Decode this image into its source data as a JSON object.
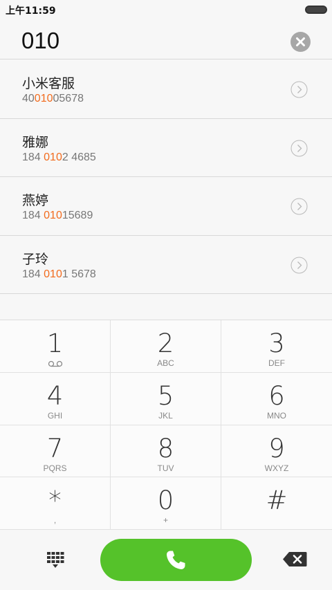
{
  "status": {
    "time": "上午11:59"
  },
  "input": {
    "number": "010"
  },
  "results": [
    {
      "name": "小米客服",
      "num_pre": "40",
      "num_hl": "010",
      "num_post": "05678"
    },
    {
      "name": "雅娜",
      "num_pre": "184 ",
      "num_hl": "010",
      "num_post": "2 4685"
    },
    {
      "name": "燕婷",
      "num_pre": "184 ",
      "num_hl": "010",
      "num_post": "15689"
    },
    {
      "name": "子玲",
      "num_pre": "184 ",
      "num_hl": "010",
      "num_post": "1 5678"
    }
  ],
  "keypad": [
    {
      "digit": "1",
      "letters": ""
    },
    {
      "digit": "2",
      "letters": "ABC"
    },
    {
      "digit": "3",
      "letters": "DEF"
    },
    {
      "digit": "4",
      "letters": "GHI"
    },
    {
      "digit": "5",
      "letters": "JKL"
    },
    {
      "digit": "6",
      "letters": "MNO"
    },
    {
      "digit": "7",
      "letters": "PQRS"
    },
    {
      "digit": "8",
      "letters": "TUV"
    },
    {
      "digit": "9",
      "letters": "WXYZ"
    },
    {
      "digit": "*",
      "letters": ","
    },
    {
      "digit": "0",
      "letters": "+"
    },
    {
      "digit": "#",
      "letters": ""
    }
  ],
  "icons": {
    "battery": "battery-icon",
    "clear": "clear-icon",
    "detail": "chevron-right-circle-icon",
    "voicemail": "voicemail-icon",
    "dialpad": "dialpad-grid-icon",
    "call": "phone-icon",
    "backspace": "backspace-icon"
  },
  "colors": {
    "highlight": "#f26b1d",
    "call_button": "#55c22a",
    "clear_button": "#a7a7a7"
  }
}
